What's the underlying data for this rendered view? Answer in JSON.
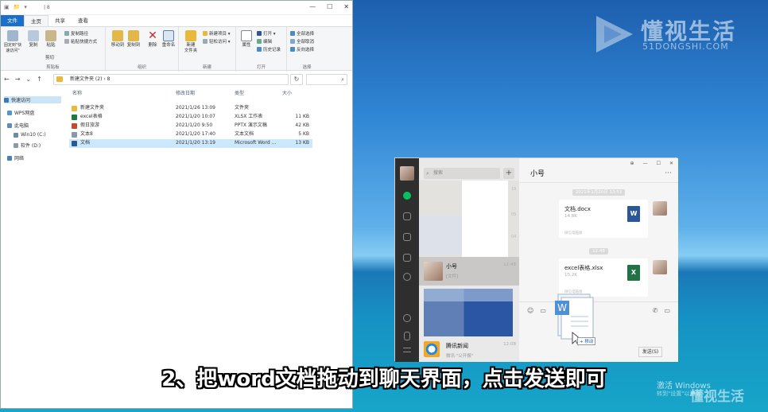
{
  "explorer": {
    "path_title": "| 8",
    "tabs": [
      "文件",
      "主页",
      "共享",
      "查看"
    ],
    "ribbon": {
      "clipboard": {
        "pin": "固定到\"快速访问\"",
        "copy": "复制",
        "paste": "粘贴",
        "cut": "剪切",
        "copy_path": "复制路径",
        "paste_shortcut": "粘贴快捷方式",
        "label": "剪贴板"
      },
      "organize": {
        "move_to": "移动到",
        "copy_to": "复制到",
        "delete": "删除",
        "rename": "重命名",
        "label": "组织"
      },
      "new": {
        "new_folder": "新建\n文件夹",
        "new_item": "新建项目 ▾",
        "easy_access": "轻松访问 ▾",
        "label": "新建"
      },
      "open": {
        "properties": "属性",
        "open": "打开 ▾",
        "edit": "编辑",
        "history": "历史记录",
        "label": "打开"
      },
      "select": {
        "select_all": "全部选择",
        "select_none": "全部取消",
        "invert": "反向选择",
        "label": "选择"
      }
    },
    "address": "新建文件夹 (2)  ›  8",
    "nav": [
      "快速访问",
      "WPS网盘",
      "此电脑",
      "Win10 (C:)",
      "软件 (D:)",
      "网络"
    ],
    "columns": [
      "名称",
      "修改日期",
      "类型",
      "大小"
    ],
    "files": [
      {
        "name": "新建文件夹",
        "date": "2021/1/26 13:09",
        "type": "文件夹",
        "size": "",
        "color": "#e8b93a"
      },
      {
        "name": "excel表格",
        "date": "2021/1/20 10:07",
        "type": "XLSX 工作表",
        "size": "11 KB",
        "color": "#1f7a3e"
      },
      {
        "name": "假日旅游",
        "date": "2021/1/20 9:50",
        "type": "PPTX 演示文稿",
        "size": "42 KB",
        "color": "#c9472b"
      },
      {
        "name": "文本8",
        "date": "2021/1/20 17:40",
        "type": "文本文档",
        "size": "5 KB",
        "color": "#8899aa"
      },
      {
        "name": "文档",
        "date": "2021/1/20 13:19",
        "type": "Microsoft Word ...",
        "size": "13 KB",
        "color": "#2b5797"
      }
    ]
  },
  "watermark": {
    "brand": "懂视生活",
    "url": "51DONGSHI.COM"
  },
  "wechat": {
    "search_placeholder": "搜索",
    "plus": "+",
    "chats": [
      {
        "name": "小号",
        "preview": "[文件]",
        "time": "12:48"
      },
      {
        "name": "腾讯新闻",
        "preview": "微讯·\"公开报\"",
        "time": "12:08"
      }
    ],
    "list_times": [
      "18",
      "05",
      "04"
    ],
    "chat_title": "小号",
    "more": "···",
    "timestamps": [
      "2021年1月20日 13:53",
      "12:48"
    ],
    "messages": [
      {
        "filename": "文档.docx",
        "size": "14.8K",
        "footer": "微信电脑版",
        "icon": "W",
        "color": "#2b579a"
      },
      {
        "filename": "excel表格.xlsx",
        "size": "10.2K",
        "footer": "微信电脑版",
        "icon": "X",
        "color": "#217346"
      }
    ],
    "send_label": "发送(S)"
  },
  "drag": {
    "label": "+ 移动"
  },
  "subtitle": "2、把word文档拖动到聊天界面，点击发送即可",
  "activate": {
    "line1": "激活 Windows",
    "line2": "转到\"设置\"以激活"
  },
  "corner_logo": "懂视生活"
}
